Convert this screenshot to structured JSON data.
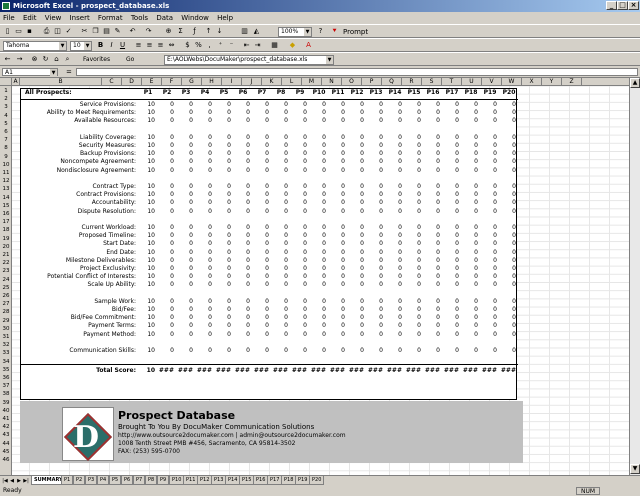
{
  "window": {
    "title": "Microsoft Excel - prospect_database.xls",
    "min": "_",
    "max": "□",
    "close": "×"
  },
  "menu": [
    "File",
    "Edit",
    "View",
    "Insert",
    "Format",
    "Tools",
    "Data",
    "Window",
    "Help"
  ],
  "toolbar": {
    "zoom": "100%",
    "prompt": "Prompt",
    "font": "Tahoma",
    "size": "10",
    "favorites": "Favorites",
    "go": "Go",
    "address": "E:\\AOLWebs\\DocuMaker\\prospect_database.xls"
  },
  "formula_bar": {
    "name_box": "A1",
    "fx": "="
  },
  "col_headers": [
    "A",
    "B",
    "C",
    "D",
    "E",
    "F",
    "G",
    "H",
    "I",
    "J",
    "K",
    "L",
    "M",
    "N",
    "O",
    "P",
    "Q",
    "R",
    "S",
    "T",
    "U",
    "V",
    "W",
    "X",
    "Y",
    "Z"
  ],
  "row_headers": [
    "1",
    "2",
    "3",
    "4",
    "5",
    "6",
    "7",
    "8",
    "9",
    "10",
    "11",
    "12",
    "13",
    "14",
    "15",
    "16",
    "17",
    "18",
    "19",
    "20",
    "21",
    "22",
    "23",
    "24",
    "25",
    "26",
    "27",
    "28",
    "29",
    "30",
    "31",
    "32",
    "33",
    "34",
    "35",
    "36",
    "37",
    "38",
    "39",
    "40",
    "41",
    "42",
    "43",
    "44",
    "45",
    "46"
  ],
  "sheet": {
    "header_label": "All Prospects:",
    "prospects": [
      "P1",
      "P2",
      "P3",
      "P4",
      "P5",
      "P6",
      "P7",
      "P8",
      "P9",
      "P10",
      "P11",
      "P12",
      "P13",
      "P14",
      "P15",
      "P16",
      "P17",
      "P18",
      "P19",
      "P20"
    ],
    "rows": [
      {
        "label": "Service Provisions:",
        "values": [
          "10",
          "0",
          "0",
          "0",
          "0",
          "0",
          "0",
          "0",
          "0",
          "0",
          "0",
          "0",
          "0",
          "0",
          "0",
          "0",
          "0",
          "0",
          "0",
          "0"
        ]
      },
      {
        "label": "Ability to Meet Requirements:",
        "values": [
          "10",
          "0",
          "0",
          "0",
          "0",
          "0",
          "0",
          "0",
          "0",
          "0",
          "0",
          "0",
          "0",
          "0",
          "0",
          "0",
          "0",
          "0",
          "0",
          "0"
        ]
      },
      {
        "label": "Available Resources:",
        "values": [
          "10",
          "0",
          "0",
          "0",
          "0",
          "0",
          "0",
          "0",
          "0",
          "0",
          "0",
          "0",
          "0",
          "0",
          "0",
          "0",
          "0",
          "0",
          "0",
          "0"
        ]
      },
      {
        "label": "",
        "values": []
      },
      {
        "label": "Liability Coverage:",
        "values": [
          "10",
          "0",
          "0",
          "0",
          "0",
          "0",
          "0",
          "0",
          "0",
          "0",
          "0",
          "0",
          "0",
          "0",
          "0",
          "0",
          "0",
          "0",
          "0",
          "0"
        ]
      },
      {
        "label": "Security Measures:",
        "values": [
          "10",
          "0",
          "0",
          "0",
          "0",
          "0",
          "0",
          "0",
          "0",
          "0",
          "0",
          "0",
          "0",
          "0",
          "0",
          "0",
          "0",
          "0",
          "0",
          "0"
        ]
      },
      {
        "label": "Backup Provisions:",
        "values": [
          "10",
          "0",
          "0",
          "0",
          "0",
          "0",
          "0",
          "0",
          "0",
          "0",
          "0",
          "0",
          "0",
          "0",
          "0",
          "0",
          "0",
          "0",
          "0",
          "0"
        ]
      },
      {
        "label": "Noncompete Agreement:",
        "values": [
          "10",
          "0",
          "0",
          "0",
          "0",
          "0",
          "0",
          "0",
          "0",
          "0",
          "0",
          "0",
          "0",
          "0",
          "0",
          "0",
          "0",
          "0",
          "0",
          "0"
        ]
      },
      {
        "label": "Nondisclosure Agreement:",
        "values": [
          "10",
          "0",
          "0",
          "0",
          "0",
          "0",
          "0",
          "0",
          "0",
          "0",
          "0",
          "0",
          "0",
          "0",
          "0",
          "0",
          "0",
          "0",
          "0",
          "0"
        ]
      },
      {
        "label": "",
        "values": []
      },
      {
        "label": "Contract Type:",
        "values": [
          "10",
          "0",
          "0",
          "0",
          "0",
          "0",
          "0",
          "0",
          "0",
          "0",
          "0",
          "0",
          "0",
          "0",
          "0",
          "0",
          "0",
          "0",
          "0",
          "0"
        ]
      },
      {
        "label": "Contract Provisions:",
        "values": [
          "10",
          "0",
          "0",
          "0",
          "0",
          "0",
          "0",
          "0",
          "0",
          "0",
          "0",
          "0",
          "0",
          "0",
          "0",
          "0",
          "0",
          "0",
          "0",
          "0"
        ]
      },
      {
        "label": "Accountability:",
        "values": [
          "10",
          "0",
          "0",
          "0",
          "0",
          "0",
          "0",
          "0",
          "0",
          "0",
          "0",
          "0",
          "0",
          "0",
          "0",
          "0",
          "0",
          "0",
          "0",
          "0"
        ]
      },
      {
        "label": "Dispute Resolution:",
        "values": [
          "10",
          "0",
          "0",
          "0",
          "0",
          "0",
          "0",
          "0",
          "0",
          "0",
          "0",
          "0",
          "0",
          "0",
          "0",
          "0",
          "0",
          "0",
          "0",
          "0"
        ]
      },
      {
        "label": "",
        "values": []
      },
      {
        "label": "Current Workload:",
        "values": [
          "10",
          "0",
          "0",
          "0",
          "0",
          "0",
          "0",
          "0",
          "0",
          "0",
          "0",
          "0",
          "0",
          "0",
          "0",
          "0",
          "0",
          "0",
          "0",
          "0"
        ]
      },
      {
        "label": "Proposed Timeline:",
        "values": [
          "10",
          "0",
          "0",
          "0",
          "0",
          "0",
          "0",
          "0",
          "0",
          "0",
          "0",
          "0",
          "0",
          "0",
          "0",
          "0",
          "0",
          "0",
          "0",
          "0"
        ]
      },
      {
        "label": "Start Date:",
        "values": [
          "10",
          "0",
          "0",
          "0",
          "0",
          "0",
          "0",
          "0",
          "0",
          "0",
          "0",
          "0",
          "0",
          "0",
          "0",
          "0",
          "0",
          "0",
          "0",
          "0"
        ]
      },
      {
        "label": "End Date:",
        "values": [
          "10",
          "0",
          "0",
          "0",
          "0",
          "0",
          "0",
          "0",
          "0",
          "0",
          "0",
          "0",
          "0",
          "0",
          "0",
          "0",
          "0",
          "0",
          "0",
          "0"
        ]
      },
      {
        "label": "Milestone Deliverables:",
        "values": [
          "10",
          "0",
          "0",
          "0",
          "0",
          "0",
          "0",
          "0",
          "0",
          "0",
          "0",
          "0",
          "0",
          "0",
          "0",
          "0",
          "0",
          "0",
          "0",
          "0"
        ]
      },
      {
        "label": "Project Exclusivity:",
        "values": [
          "10",
          "0",
          "0",
          "0",
          "0",
          "0",
          "0",
          "0",
          "0",
          "0",
          "0",
          "0",
          "0",
          "0",
          "0",
          "0",
          "0",
          "0",
          "0",
          "0"
        ]
      },
      {
        "label": "Potential Conflict of Interests:",
        "values": [
          "10",
          "0",
          "0",
          "0",
          "0",
          "0",
          "0",
          "0",
          "0",
          "0",
          "0",
          "0",
          "0",
          "0",
          "0",
          "0",
          "0",
          "0",
          "0",
          "0"
        ]
      },
      {
        "label": "Scale Up Ability:",
        "values": [
          "10",
          "0",
          "0",
          "0",
          "0",
          "0",
          "0",
          "0",
          "0",
          "0",
          "0",
          "0",
          "0",
          "0",
          "0",
          "0",
          "0",
          "0",
          "0",
          "0"
        ]
      },
      {
        "label": "",
        "values": []
      },
      {
        "label": "Sample Work:",
        "values": [
          "10",
          "0",
          "0",
          "0",
          "0",
          "0",
          "0",
          "0",
          "0",
          "0",
          "0",
          "0",
          "0",
          "0",
          "0",
          "0",
          "0",
          "0",
          "0",
          "0"
        ]
      },
      {
        "label": "Bid/Fee:",
        "values": [
          "10",
          "0",
          "0",
          "0",
          "0",
          "0",
          "0",
          "0",
          "0",
          "0",
          "0",
          "0",
          "0",
          "0",
          "0",
          "0",
          "0",
          "0",
          "0",
          "0"
        ]
      },
      {
        "label": "Bid/Fee Commitment:",
        "values": [
          "10",
          "0",
          "0",
          "0",
          "0",
          "0",
          "0",
          "0",
          "0",
          "0",
          "0",
          "0",
          "0",
          "0",
          "0",
          "0",
          "0",
          "0",
          "0",
          "0"
        ]
      },
      {
        "label": "Payment Terms:",
        "values": [
          "10",
          "0",
          "0",
          "0",
          "0",
          "0",
          "0",
          "0",
          "0",
          "0",
          "0",
          "0",
          "0",
          "0",
          "0",
          "0",
          "0",
          "0",
          "0",
          "0"
        ]
      },
      {
        "label": "Payment Method:",
        "values": [
          "10",
          "0",
          "0",
          "0",
          "0",
          "0",
          "0",
          "0",
          "0",
          "0",
          "0",
          "0",
          "0",
          "0",
          "0",
          "0",
          "0",
          "0",
          "0",
          "0"
        ]
      },
      {
        "label": "",
        "values": []
      },
      {
        "label": "Communication Skills:",
        "values": [
          "10",
          "0",
          "0",
          "0",
          "0",
          "0",
          "0",
          "0",
          "0",
          "0",
          "0",
          "0",
          "0",
          "0",
          "0",
          "0",
          "0",
          "0",
          "0",
          "0"
        ]
      },
      {
        "label": "",
        "values": []
      },
      {
        "label": "Total Score:",
        "values": [
          "10",
          "###",
          "###",
          "###",
          "###",
          "###",
          "###",
          "###",
          "###",
          "###",
          "###",
          "###",
          "###",
          "###",
          "###",
          "###",
          "###",
          "###",
          "###",
          "###"
        ],
        "total": true
      }
    ]
  },
  "branding": {
    "title": "Prospect Database",
    "tagline": "Brought To You By DocuMaker Communication Solutions",
    "contact": "http://www.outsource2documaker.com | admin@outsource2documaker.com",
    "address": "1008 Tenth Street PMB #456, Sacramento, CA 95814-3502",
    "fax": "FAX: (253) 595-0700",
    "logo_letter": "D"
  },
  "tabs": [
    "SUMMARY",
    "P1",
    "P2",
    "P3",
    "P4",
    "P5",
    "P6",
    "P7",
    "P8",
    "P9",
    "P10",
    "P11",
    "P12",
    "P13",
    "P14",
    "P15",
    "P16",
    "P17",
    "P18",
    "P19",
    "P20"
  ],
  "status": {
    "left": "Ready",
    "num": "NUM"
  }
}
